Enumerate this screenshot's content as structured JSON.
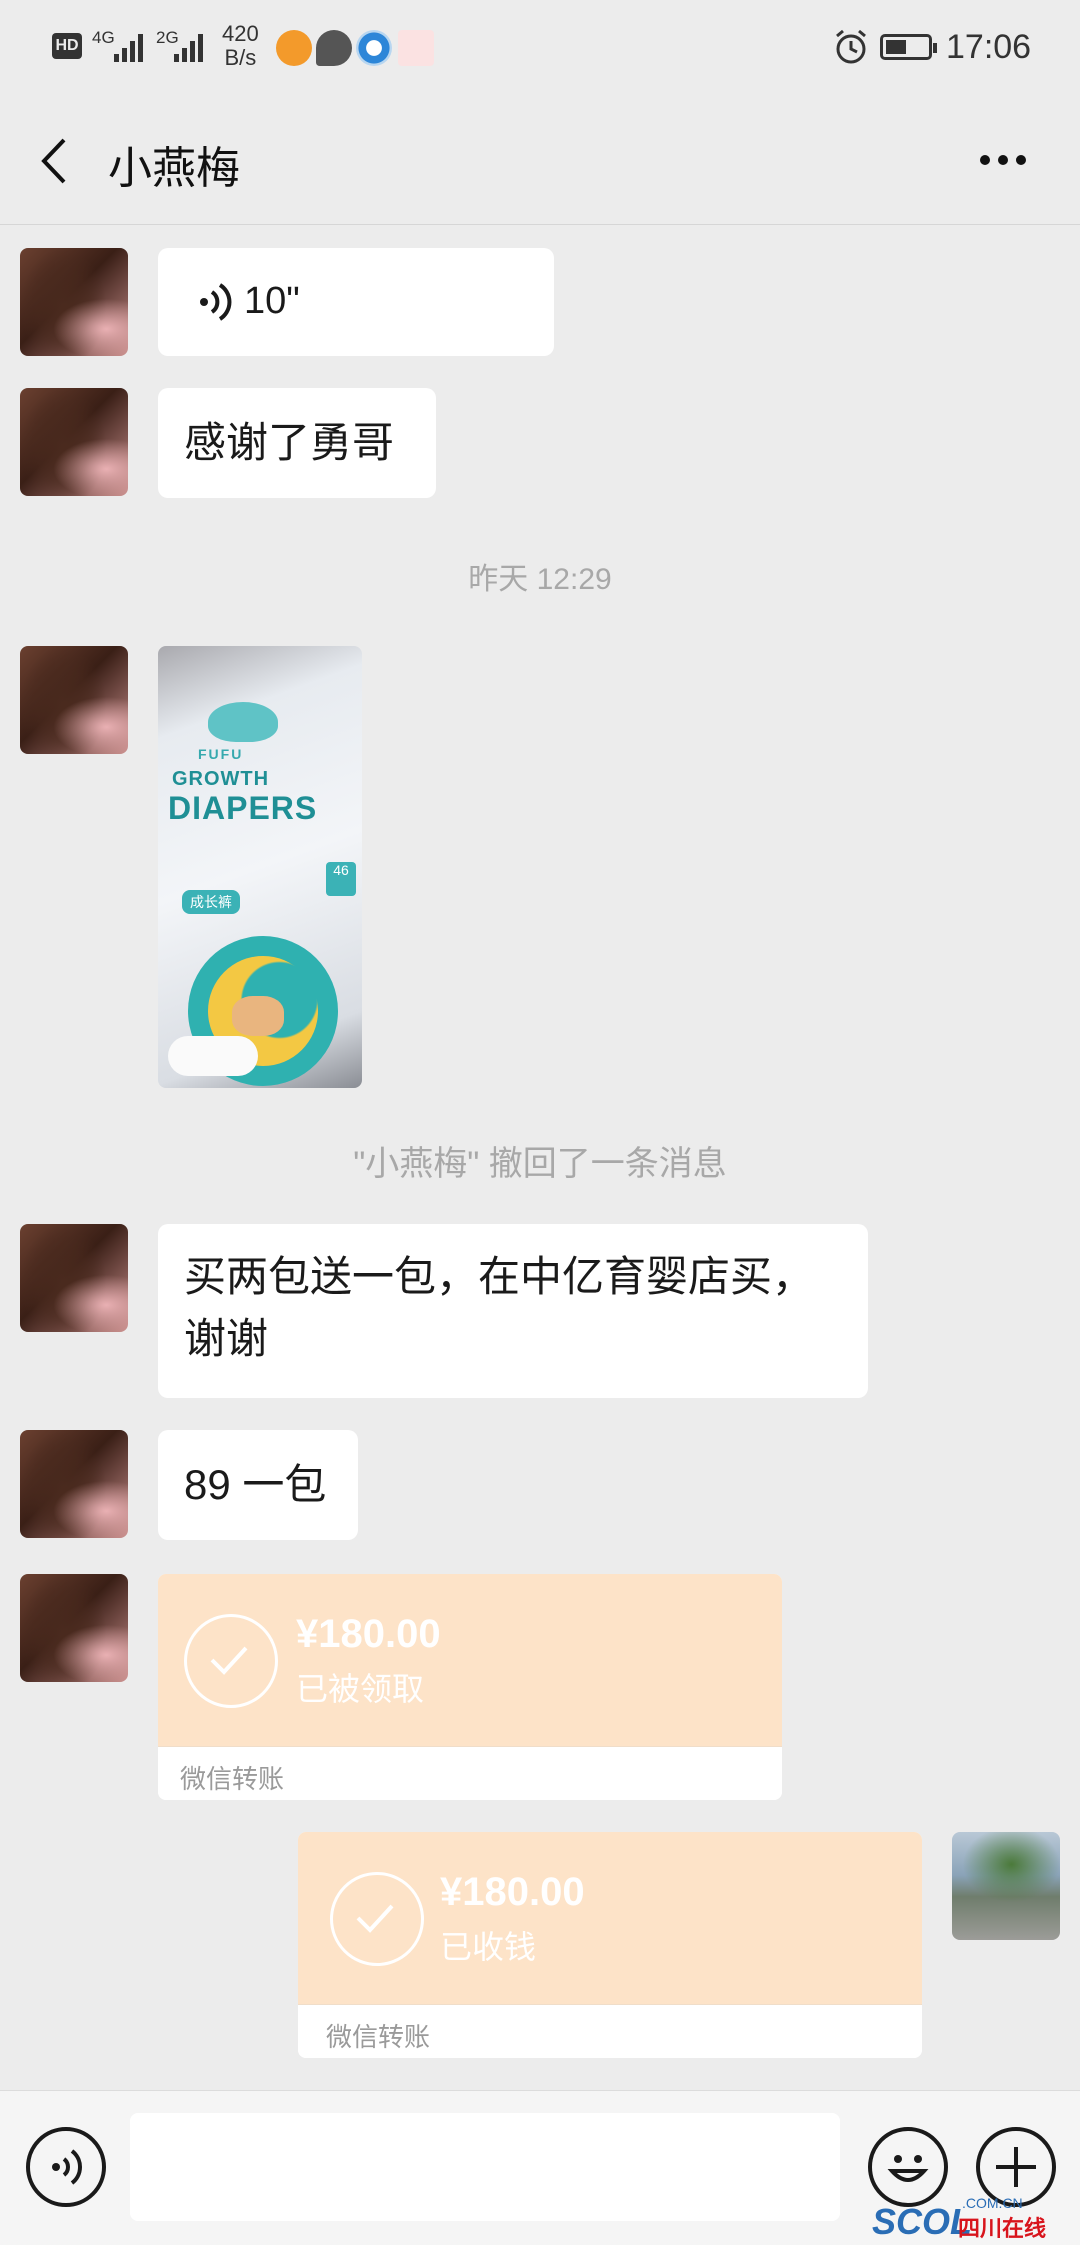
{
  "status_bar": {
    "hd": "HD",
    "net1": "4G",
    "net2": "2G",
    "speed_value": "420",
    "speed_unit": "B/s",
    "time": "17:06"
  },
  "header": {
    "title": "小燕梅"
  },
  "messages": {
    "voice_duration": "10\"",
    "thanks": "感谢了勇哥",
    "timestamp": "昨天 12:29",
    "recall_notice": "\"小燕梅\" 撤回了一条消息",
    "buy_line1": "买两包送一包，在中亿育婴店买，",
    "buy_line2": "谢谢",
    "price": "89 一包"
  },
  "product_image": {
    "brand": "FUFU",
    "line1": "GROWTH",
    "line2": "DIAPERS",
    "tag": "成长裤",
    "count": "46"
  },
  "transfer_received": {
    "amount": "¥180.00",
    "status": "已被领取",
    "label": "微信转账"
  },
  "transfer_sent": {
    "amount": "¥180.00",
    "status": "已收钱",
    "label": "微信转账"
  },
  "watermark": {
    "brand": "SCOL",
    "domain": ".COM.CN",
    "text": "四川在线"
  },
  "colors": {
    "background": "#ececec",
    "bubble": "#ffffff",
    "transfer": "#fde3c8",
    "accent_red": "#d8141c"
  }
}
